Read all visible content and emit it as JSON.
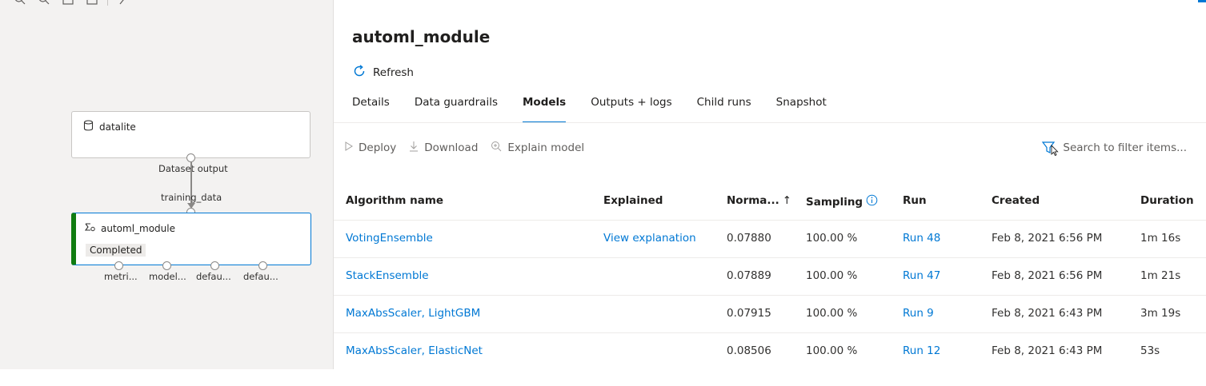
{
  "canvas": {
    "nodes": {
      "dataset": {
        "name": "datalite",
        "output_label": "Dataset output"
      },
      "module": {
        "name": "automl_module",
        "input_label": "training_data",
        "status": "Completed"
      }
    },
    "output_ports": [
      "metri...",
      "model...",
      "defau...",
      "defau..."
    ]
  },
  "panel": {
    "title": "automl_module",
    "refresh_label": "Refresh",
    "tabs": [
      "Details",
      "Data guardrails",
      "Models",
      "Outputs + logs",
      "Child runs",
      "Snapshot"
    ],
    "active_tab": "Models",
    "commands": {
      "deploy": "Deploy",
      "download": "Download",
      "explain": "Explain model"
    },
    "filter_placeholder": "Search to filter items...",
    "columns": {
      "algorithm": "Algorithm name",
      "explained": "Explained",
      "normalized": "Norma...",
      "sort_indicator": "↑",
      "sampling": "Sampling",
      "run": "Run",
      "created": "Created",
      "duration": "Duration"
    },
    "rows": [
      {
        "algorithm": "VotingEnsemble",
        "explained": "View explanation",
        "normalized": "0.07880",
        "sampling": "100.00 %",
        "run": "Run 48",
        "created": "Feb 8, 2021 6:56 PM",
        "duration": "1m 16s"
      },
      {
        "algorithm": "StackEnsemble",
        "explained": "",
        "normalized": "0.07889",
        "sampling": "100.00 %",
        "run": "Run 47",
        "created": "Feb 8, 2021 6:56 PM",
        "duration": "1m 21s"
      },
      {
        "algorithm": "MaxAbsScaler, LightGBM",
        "explained": "",
        "normalized": "0.07915",
        "sampling": "100.00 %",
        "run": "Run 9",
        "created": "Feb 8, 2021 6:43 PM",
        "duration": "3m 19s"
      },
      {
        "algorithm": "MaxAbsScaler, ElasticNet",
        "explained": "",
        "normalized": "0.08506",
        "sampling": "100.00 %",
        "run": "Run 12",
        "created": "Feb 8, 2021 6:43 PM",
        "duration": "53s"
      }
    ]
  },
  "colors": {
    "accent": "#0078d4",
    "success": "#107c10",
    "canvas_bg": "#f3f2f1"
  },
  "icons": [
    "zoom-in-icon",
    "zoom-out-icon",
    "fit-view-icon",
    "minimap-icon",
    "pan-icon",
    "database-icon",
    "automl-icon",
    "refresh-icon",
    "play-icon",
    "download-icon",
    "explain-icon",
    "filter-icon",
    "info-icon",
    "cursor-icon"
  ]
}
